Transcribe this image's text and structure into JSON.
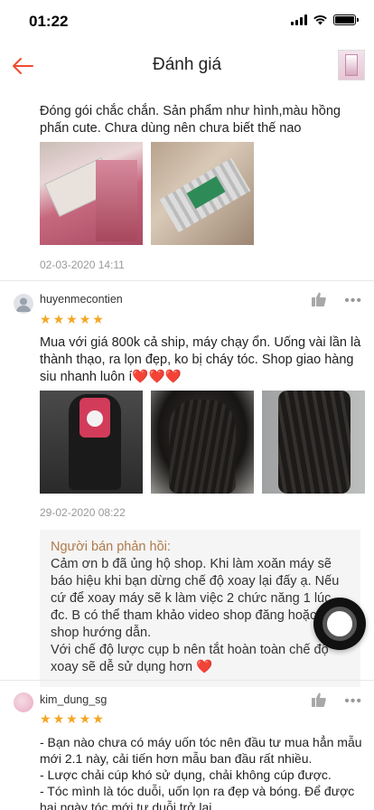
{
  "status_bar": {
    "time": "01:22"
  },
  "header": {
    "title": "Đánh giá"
  },
  "review_top": {
    "text": "Đóng gói chắc chắn. Sản phẩm như hình,màu hồng phấn cute. Chưa dùng nên chưa biết thế nao",
    "date": "02-03-2020 14:11"
  },
  "review_2": {
    "username": "huyenmecontien",
    "rating": 5,
    "text": "Mua với giá 800k cả ship, máy chạy ổn. Uống vài lần là thành thạo, ra lọn đẹp, ko bị cháy tóc. Shop giao hàng siu nhanh luôn í❤️❤️❤️",
    "date": "29-02-2020 08:22",
    "seller_reply": {
      "title": "Người bán phản hồi:",
      "text": "Cảm ơn b đã ủng hộ shop. Khi làm xoăn máy sẽ báo hiệu khi bạn dừng chế độ xoay lại đấy ạ. Nếu cứ để xoay máy sẽ k làm việc 2 chức năng 1 lúc đc. B có thể tham khảo video shop đăng hoặc ib shop hướng dẫn.\nVới chế độ lược cụp b nên tắt hoàn toàn chế độ xoay sẽ dễ sử dụng hơn ❤️"
    }
  },
  "review_3": {
    "username": "kim_dung_sg",
    "rating": 5,
    "text": "- Bạn nào chưa có máy uốn tóc nên đầu tư mua hẳn mẫu mới 2.1 này, cải tiến hơn mẫu ban đầu rất nhiều.\n- Lược chải cúp khó sử dụng, chải không cúp được.\n- Tóc mình là tóc duỗi, uốn lọn ra đẹp và bóng. Để được hai ngày tóc mới tự duỗi trở lại."
  },
  "colors": {
    "accent": "#ee4d2d",
    "star": "#f5a623",
    "seller_title": "#b07a4a"
  },
  "icons": [
    "back-arrow-icon",
    "thumbs-up-icon",
    "more-dots-icon",
    "star-icon"
  ]
}
